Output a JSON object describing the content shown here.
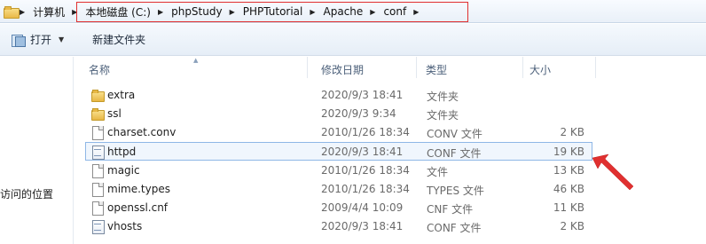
{
  "address": {
    "crumbs": [
      "计算机",
      "本地磁盘 (C:)",
      "phpStudy",
      "PHPTutorial",
      "Apache",
      "conf"
    ]
  },
  "toolbar": {
    "open_label": "打开",
    "new_folder_label": "新建文件夹"
  },
  "nav": {
    "partial_label": "访问的位置"
  },
  "columns": {
    "name": "名称",
    "date": "修改日期",
    "type": "类型",
    "size": "大小"
  },
  "files": [
    {
      "name": "extra",
      "date": "2020/9/3 18:41",
      "type": "文件夹",
      "size": "",
      "icon": "folder-icon"
    },
    {
      "name": "ssl",
      "date": "2020/9/3 9:34",
      "type": "文件夹",
      "size": "",
      "icon": "folder-icon"
    },
    {
      "name": "charset.conv",
      "date": "2010/1/26 18:34",
      "type": "CONV 文件",
      "size": "2 KB",
      "icon": "file-icon"
    },
    {
      "name": "httpd",
      "date": "2020/9/3 18:41",
      "type": "CONF 文件",
      "size": "19 KB",
      "icon": "conf-file-icon",
      "selected": true
    },
    {
      "name": "magic",
      "date": "2010/1/26 18:34",
      "type": "文件",
      "size": "13 KB",
      "icon": "file-icon"
    },
    {
      "name": "mime.types",
      "date": "2010/1/26 18:34",
      "type": "TYPES 文件",
      "size": "46 KB",
      "icon": "file-icon"
    },
    {
      "name": "openssl.cnf",
      "date": "2009/4/4 10:09",
      "type": "CNF 文件",
      "size": "11 KB",
      "icon": "file-icon"
    },
    {
      "name": "vhosts",
      "date": "2020/9/3 18:41",
      "type": "CONF 文件",
      "size": "2 KB",
      "icon": "conf-file-icon"
    }
  ],
  "colors": {
    "annotation": "#e03030",
    "selection_border": "#8fb7e6",
    "selection_fill": "#f0f6fd"
  }
}
